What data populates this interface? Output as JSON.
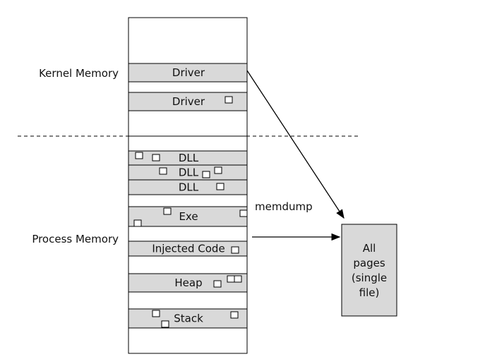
{
  "labels": {
    "kernel": "Kernel Memory",
    "process": "Process Memory",
    "memdump": "memdump"
  },
  "segments": [
    {
      "label": "Driver"
    },
    {
      "label": "Driver"
    },
    {
      "label": "DLL"
    },
    {
      "label": "DLL"
    },
    {
      "label": "DLL"
    },
    {
      "label": "Exe"
    },
    {
      "label": "Injected Code"
    },
    {
      "label": "Heap"
    },
    {
      "label": "Stack"
    }
  ],
  "output": {
    "lines": [
      "All",
      "pages",
      "(single",
      "file)"
    ]
  },
  "colors": {
    "segment": "#d9d9d9",
    "output_box": "#d9d9d9",
    "stroke": "#000000"
  }
}
